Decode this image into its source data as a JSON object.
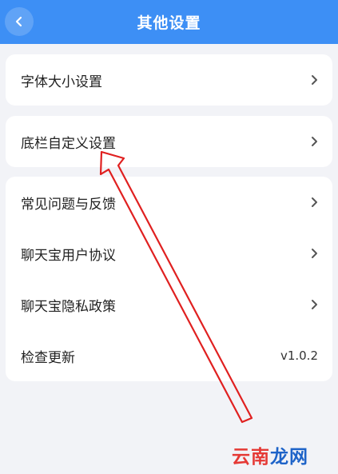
{
  "header": {
    "title": "其他设置",
    "back_icon": "chevron-left-icon"
  },
  "settings": {
    "font_size": "字体大小设置",
    "bottom_bar": "底栏自定义设置",
    "faq": "常见问题与反馈",
    "user_agreement": "聊天宝用户协议",
    "privacy_policy": "聊天宝隐私政策",
    "check_update": "检查更新",
    "version": "v1.0.2"
  },
  "watermark": {
    "part1": "云南",
    "part2": "龙网"
  },
  "colors": {
    "header": "#3d8ff5",
    "background": "#f2f3f7",
    "annotation_arrow": "#e02020",
    "watermark_red": "#e53935",
    "watermark_blue": "#1e63c8"
  }
}
